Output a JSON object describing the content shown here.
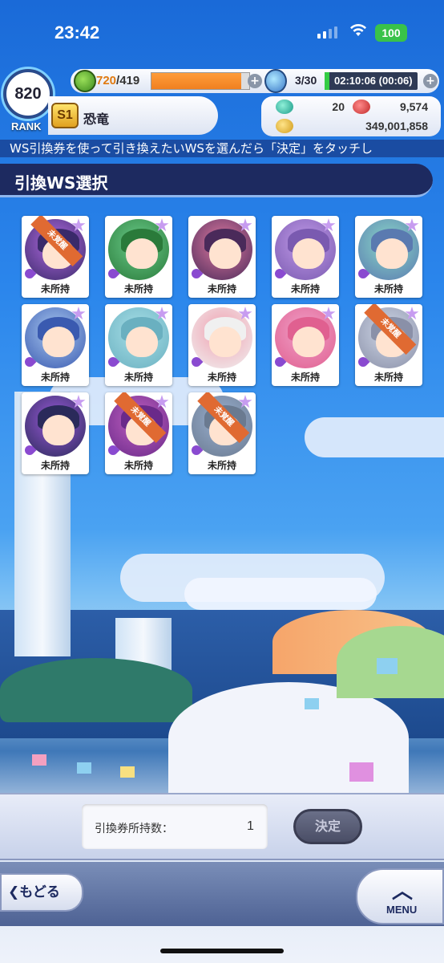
{
  "status_bar": {
    "time": "23:42",
    "battery": "100"
  },
  "header": {
    "rank": "820",
    "rank_label": "RANK",
    "stamina_current": "720",
    "stamina_max": "/419",
    "potion": "3/30",
    "timer": "02:10:06 (00:06)",
    "title_badge": "S1",
    "player_title": "恐竜",
    "currency_1": "20",
    "currency_2": "9,574",
    "currency_3": "349,001,858"
  },
  "ticker_text": "WS引換券を使って引き換えたいWSを選んだら「決定」をタッチし",
  "section_title": "引換WS選択",
  "cards": [
    {
      "label": "未所持",
      "ribbon": "未覚醒"
    },
    {
      "label": "未所持",
      "ribbon": ""
    },
    {
      "label": "未所持",
      "ribbon": ""
    },
    {
      "label": "未所持",
      "ribbon": ""
    },
    {
      "label": "未所持",
      "ribbon": ""
    },
    {
      "label": "未所持",
      "ribbon": ""
    },
    {
      "label": "未所持",
      "ribbon": ""
    },
    {
      "label": "未所持",
      "ribbon": ""
    },
    {
      "label": "未所持",
      "ribbon": ""
    },
    {
      "label": "未所持",
      "ribbon": "未覚醒"
    },
    {
      "label": "未所持",
      "ribbon": ""
    },
    {
      "label": "未所持",
      "ribbon": "未覚醒"
    },
    {
      "label": "未所持",
      "ribbon": "未覚醒"
    }
  ],
  "bottom": {
    "ticket_label": "引換券所持数：",
    "ticket_count": "1",
    "decide_label": "決定",
    "back_label": "❮もどる",
    "menu_label": "MENU"
  },
  "colors": {
    "accent_orange": "#e06a32",
    "header_navy": "#1d2a60",
    "stamina_orange": "#f08020"
  }
}
